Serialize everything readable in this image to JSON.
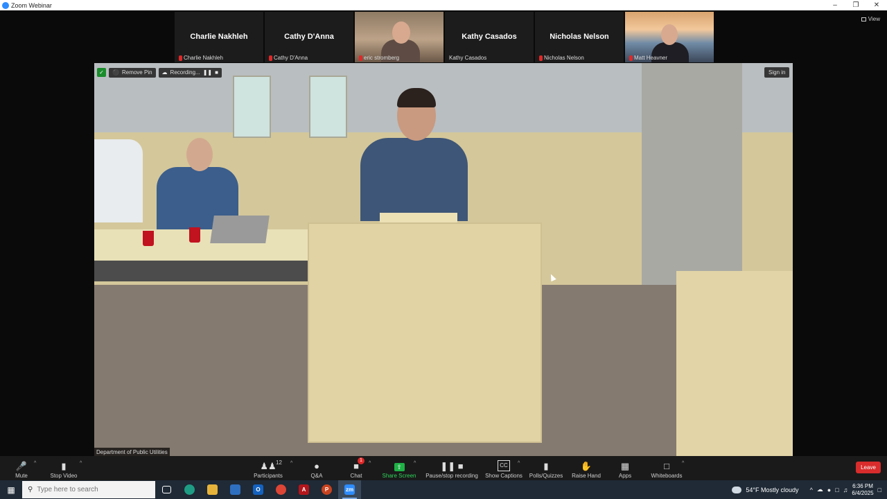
{
  "window": {
    "title": "Zoom Webinar"
  },
  "view_label": "View",
  "participants_strip": [
    {
      "display_name": "Charlie Nakhleh",
      "label": "Charlie Nakhleh",
      "video": false
    },
    {
      "display_name": "Cathy D'Anna",
      "label": "Cathy D'Anna",
      "video": false
    },
    {
      "display_name": "",
      "label": "eric stromberg",
      "video": true
    },
    {
      "display_name": "Kathy Casados",
      "label": "Kathy Casados",
      "video": false
    },
    {
      "display_name": "Nicholas Nelson",
      "label": "Nicholas Nelson",
      "video": false
    },
    {
      "display_name": "",
      "label": "Matt Heavner",
      "video": true
    }
  ],
  "main_video": {
    "remove_pin_label": "Remove Pin",
    "recording_label": "Recording...",
    "sign_in_label": "Sign in",
    "source_label": "Department of Public Utilities"
  },
  "toolbar": {
    "mute": "Mute",
    "stop_video": "Stop Video",
    "participants": "Participants",
    "participants_count": "12",
    "qa": "Q&A",
    "chat": "Chat",
    "chat_badge": "1",
    "share_screen": "Share Screen",
    "pause_recording": "Pause/stop recording",
    "show_captions": "Show Captions",
    "polls": "Polls/Quizzes",
    "raise_hand": "Raise Hand",
    "apps": "Apps",
    "whiteboards": "Whiteboards",
    "leave": "Leave"
  },
  "taskbar": {
    "search_placeholder": "Type here to search",
    "weather": "54°F  Mostly cloudy",
    "time": "6:36 PM",
    "date": "6/4/2025"
  },
  "colors": {
    "zoom_blue": "#2d8cff",
    "share_green": "#1fb146",
    "leave_red": "#d92c2c"
  }
}
